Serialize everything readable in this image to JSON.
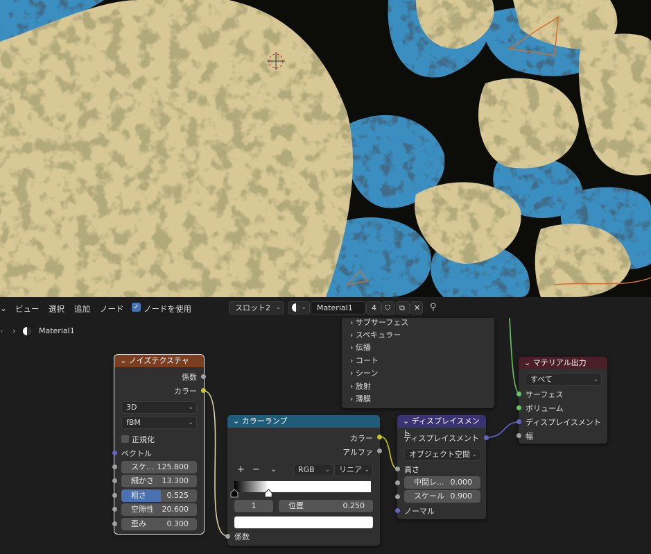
{
  "header": {
    "menus": [
      "ビュー",
      "選択",
      "追加",
      "ノード"
    ],
    "use_nodes_label": "ノードを使用",
    "slot": "スロット2",
    "material_name": "Material1",
    "users": "4"
  },
  "breadcrumb": {
    "material": "Material1"
  },
  "panel": {
    "items": [
      "サブサーフェス",
      "スペキュラー",
      "伝播",
      "コート",
      "シーン",
      "放射",
      "薄膜"
    ]
  },
  "noise": {
    "title": "ノイズテクスチャ",
    "out_fac": "係数",
    "out_color": "カラー",
    "dimensions": "3D",
    "type": "fBM",
    "normalize": "正規化",
    "vector": "ベクトル",
    "fields": [
      {
        "label": "スケ...",
        "value": "125.800"
      },
      {
        "label": "細かさ",
        "value": "13.300"
      },
      {
        "label": "粗さ",
        "value": "0.525"
      },
      {
        "label": "空隙性",
        "value": "20.600"
      },
      {
        "label": "歪み",
        "value": "0.300"
      }
    ]
  },
  "ramp": {
    "title": "カラーランプ",
    "out_color": "カラー",
    "out_alpha": "アルファ",
    "plus": "+",
    "minus": "−",
    "mode": "RGB",
    "interp": "リニア",
    "index": "1",
    "pos_label": "位置",
    "pos_value": "0.250",
    "in_fac": "係数",
    "stops": [
      0.0,
      0.25
    ]
  },
  "disp": {
    "title": "ディスプレイスメント",
    "out": "ディスプレイスメント",
    "space": "オブジェクト空間",
    "height": "高さ",
    "fields": [
      {
        "label": "中間レ...",
        "value": "0.000"
      },
      {
        "label": "スケール",
        "value": "0.900"
      }
    ],
    "normal": "ノーマル"
  },
  "output": {
    "title": "マテリアル出力",
    "target": "すべて",
    "surface": "サーフェス",
    "volume": "ボリューム",
    "displacement": "ディスプレイスメント",
    "thickness": "幅"
  },
  "colors": {
    "noise_header": "#7b3e21",
    "ramp_header": "#1e5c79",
    "disp_header": "#3b3274",
    "output_header": "#4a1f28",
    "slider_fill": "#4a72b3",
    "blue": "#3a8fc0",
    "sand": "#d8c896"
  }
}
